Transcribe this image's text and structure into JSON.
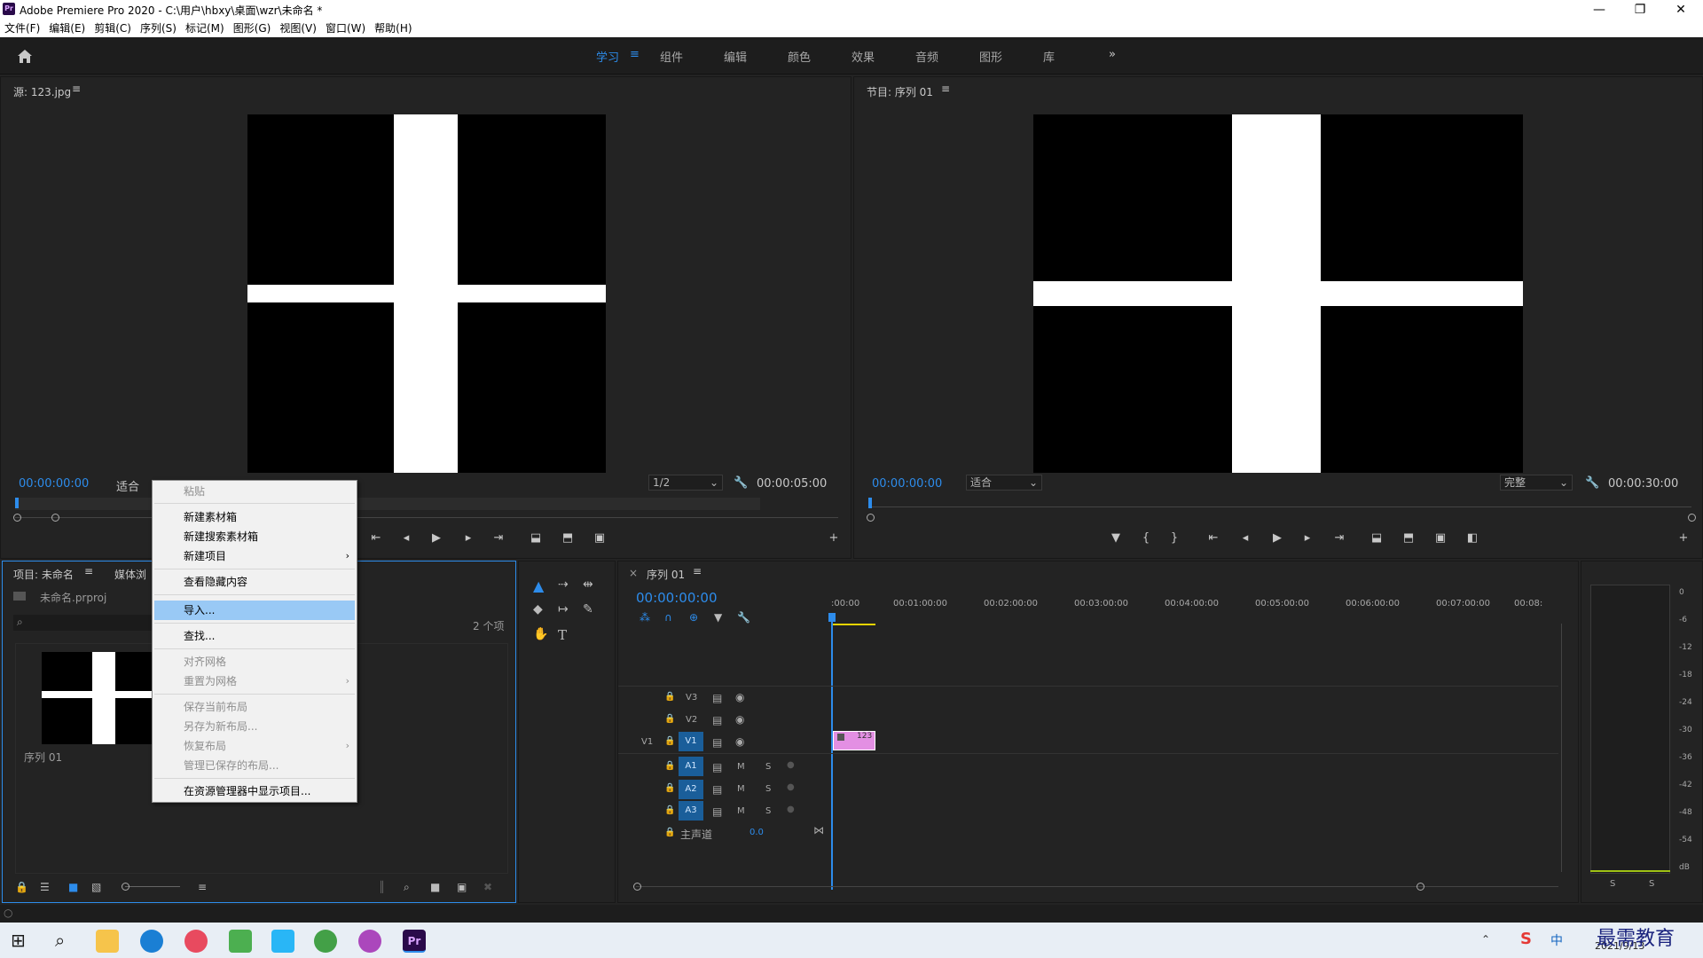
{
  "window": {
    "title": "Adobe Premiere Pro 2020 - C:\\用户\\hbxy\\桌面\\wzr\\未命名 *",
    "app_icon": "Pr"
  },
  "menu": [
    "文件(F)",
    "编辑(E)",
    "剪辑(C)",
    "序列(S)",
    "标记(M)",
    "图形(G)",
    "视图(V)",
    "窗口(W)",
    "帮助(H)"
  ],
  "workspaces": {
    "active": "学习",
    "items": [
      "组件",
      "编辑",
      "颜色",
      "效果",
      "音频",
      "图形",
      "库"
    ],
    "more": "»"
  },
  "source_monitor": {
    "title": "源: 123.jpg",
    "timecode": "00:00:00:00",
    "fit": "适合",
    "resolution": "1/2",
    "duration": "00:00:05:00"
  },
  "program_monitor": {
    "title": "节目: 序列 01",
    "timecode": "00:00:00:00",
    "fit": "适合",
    "quality": "完整",
    "duration": "00:00:30:00"
  },
  "project_panel": {
    "tab_project": "项目: 未命名",
    "tab_media": "媒体浏",
    "file": "未命名.prproj",
    "count": "2 个项",
    "item_label": "序列 01"
  },
  "context_menu": {
    "items": [
      {
        "label": "粘贴",
        "disabled": true
      },
      {
        "label": "新建素材箱",
        "disabled": false
      },
      {
        "label": "新建搜索素材箱",
        "disabled": false
      },
      {
        "label": "新建项目",
        "disabled": false,
        "submenu": true
      },
      {
        "label": "查看隐藏内容",
        "disabled": false
      },
      {
        "label": "导入...",
        "disabled": false,
        "highlighted": true
      },
      {
        "label": "查找...",
        "disabled": false
      },
      {
        "label": "对齐网格",
        "disabled": true
      },
      {
        "label": "重置为网格",
        "disabled": true,
        "submenu": true
      },
      {
        "label": "保存当前布局",
        "disabled": true
      },
      {
        "label": "另存为新布局...",
        "disabled": true
      },
      {
        "label": "恢复布局",
        "disabled": true,
        "submenu": true
      },
      {
        "label": "管理已保存的布局...",
        "disabled": true
      },
      {
        "label": "在资源管理器中显示项目...",
        "disabled": false
      }
    ]
  },
  "timeline": {
    "tab": "序列 01",
    "timecode": "00:00:00:00",
    "ruler": [
      ":00:00",
      "00:01:00:00",
      "00:02:00:00",
      "00:03:00:00",
      "00:04:00:00",
      "00:05:00:00",
      "00:06:00:00",
      "00:07:00:00",
      "00:08:"
    ],
    "video_tracks": [
      "V3",
      "V2",
      "V1"
    ],
    "source_patch": "V1",
    "audio_tracks": [
      "A1",
      "A2",
      "A3"
    ],
    "mute": "M",
    "solo": "S",
    "master": "主声道",
    "master_value": "0.0",
    "clip_label": "123"
  },
  "audio_meter": {
    "scale": [
      "0",
      "-6",
      "-12",
      "-18",
      "-24",
      "-30",
      "-36",
      "-42",
      "-48",
      "-54",
      "dB"
    ],
    "solo_labels": [
      "S",
      "S"
    ]
  },
  "taskbar": {
    "ime": "中",
    "date": "2021/9/13",
    "watermark": "最需教育"
  },
  "colors": {
    "accent": "#2d8ceb",
    "panel_bg": "#232323",
    "clip": "#e38fe3",
    "playhead": "#2d8ceb"
  }
}
